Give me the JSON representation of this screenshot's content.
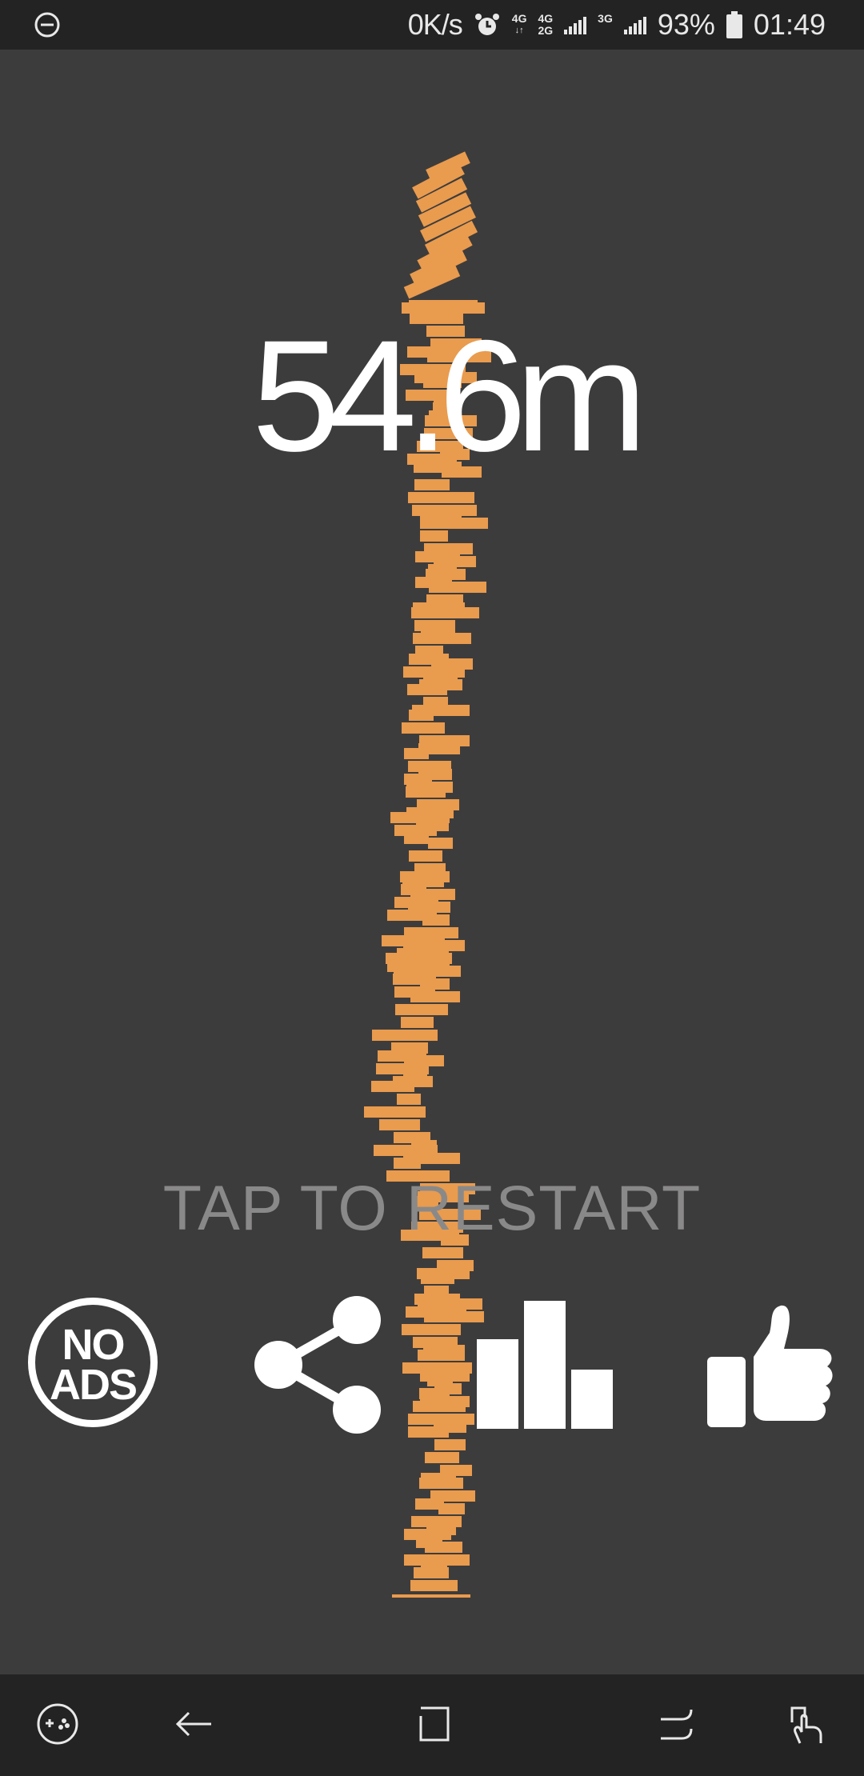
{
  "status_bar": {
    "speed": "0K/s",
    "network_1": "4G",
    "network_2_top": "4G",
    "network_2_bottom": "2G",
    "network_3": "3G",
    "battery_percent": "93%",
    "time": "01:49",
    "icons": [
      "do-not-disturb-icon",
      "alarm-icon",
      "signal-icon",
      "battery-icon"
    ]
  },
  "game": {
    "score": "54.6m",
    "restart_text": "TAP TO RESTART",
    "block_color": "#e99b4e",
    "text_color": "#ffffff",
    "restart_color": "#8a8989"
  },
  "buttons": {
    "no_ads_line1": "NO",
    "no_ads_line2": "ADS",
    "icons": [
      "share-icon",
      "leaderboard-icon",
      "thumbs-up-icon"
    ]
  },
  "nav_bar": {
    "icons": [
      "game-tools-icon",
      "back-icon",
      "home-icon",
      "recents-icon",
      "assistant-gesture-icon"
    ]
  }
}
